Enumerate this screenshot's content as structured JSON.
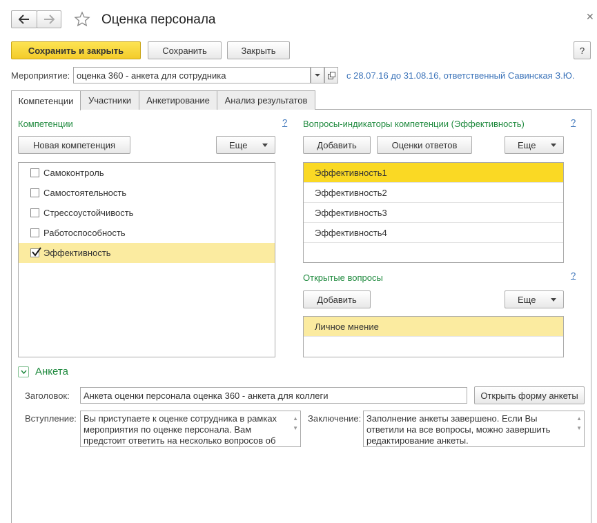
{
  "window": {
    "title": "Оценка персонала"
  },
  "toolbar": {
    "save_close": "Сохранить и закрыть",
    "save": "Сохранить",
    "close": "Закрыть",
    "help": "?"
  },
  "event": {
    "label": "Мероприятие:",
    "value": "оценка 360 - анкета для сотрудника",
    "info": "с 28.07.16 до 31.08.16, ответственный Савинская З.Ю."
  },
  "tabs": [
    "Компетенции",
    "Участники",
    "Анкетирование",
    "Анализ результатов"
  ],
  "competencies": {
    "title": "Компетенции",
    "help": "?",
    "new_button": "Новая компетенция",
    "more_button": "Еще",
    "items": [
      {
        "label": "Самоконтроль",
        "checked": false
      },
      {
        "label": "Самостоятельность",
        "checked": false
      },
      {
        "label": "Стрессоустойчивость",
        "checked": false
      },
      {
        "label": "Работоспособность",
        "checked": false
      },
      {
        "label": "Эффективность",
        "checked": true
      }
    ]
  },
  "indicators": {
    "title": "Вопросы-индикаторы компетенции (Эффективность)",
    "help": "?",
    "add_button": "Добавить",
    "ratings_button": "Оценки ответов",
    "more_button": "Еще",
    "items": [
      "Эффективность1",
      "Эффективность2",
      "Эффективность3",
      "Эффективность4"
    ]
  },
  "open_questions": {
    "title": "Открытые вопросы",
    "help": "?",
    "add_button": "Добавить",
    "more_button": "Еще",
    "items": [
      "Личное мнение"
    ]
  },
  "questionnaire": {
    "title": "Анкета",
    "header_label": "Заголовок:",
    "header_value": "Анкета оценки персонала оценка 360 - анкета для коллеги",
    "open_form_button": "Открыть форму анкеты",
    "intro_label": "Вступление:",
    "intro_value": "Вы приступаете к оценке сотрудника в рамках мероприятия по оценке персонала. Вам предстоит ответить на несколько вопросов об",
    "conclusion_label": "Заключение:",
    "conclusion_value": "Заполнение анкеты завершено. Если Вы ответили на все вопросы, можно завершить редактирование анкеты."
  }
}
